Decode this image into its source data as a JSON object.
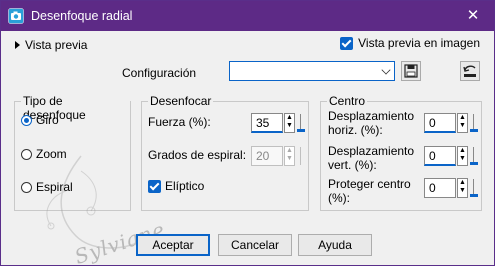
{
  "title": "Desenfoque radial",
  "preview": {
    "label": "Vista previa"
  },
  "live_preview": {
    "label": "Vista previa en imagen",
    "checked": true
  },
  "config": {
    "label": "Configuración",
    "value": ""
  },
  "blur_type": {
    "title": "Tipo de desenfoque",
    "options": [
      {
        "label": "Giro",
        "selected": true
      },
      {
        "label": "Zoom",
        "selected": false
      },
      {
        "label": "Espiral",
        "selected": false
      }
    ]
  },
  "blur": {
    "title": "Desenfocar",
    "strength_label": "Fuerza (%):",
    "strength_value": "35",
    "spiral_label": "Grados de espiral:",
    "spiral_value": "20",
    "elliptic_label": "Elíptico"
  },
  "center": {
    "title": "Centro",
    "horiz_label_1": "Desplazamiento",
    "horiz_label_2": "horiz. (%):",
    "horiz_value": "0",
    "vert_label_1": "Desplazamiento",
    "vert_label_2": "vert. (%):",
    "vert_value": "0",
    "protect_label_1": "Proteger centro",
    "protect_label_2": "(%):",
    "protect_value": "0"
  },
  "watermark": "Sylviane",
  "buttons": {
    "ok": "Aceptar",
    "cancel": "Cancelar",
    "help": "Ayuda"
  },
  "colors": {
    "titlebar": "#5d2a86",
    "accent": "#0a64c8"
  }
}
